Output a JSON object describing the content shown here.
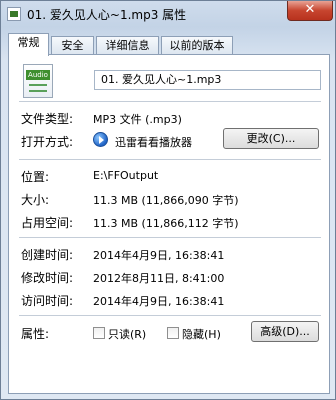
{
  "window": {
    "title": "01. 爱久见人心~1.mp3 属性",
    "close_label": "✕"
  },
  "tabs": [
    {
      "label": "常规",
      "active": true
    },
    {
      "label": "安全",
      "active": false
    },
    {
      "label": "详细信息",
      "active": false
    },
    {
      "label": "以前的版本",
      "active": false
    }
  ],
  "general": {
    "filename": "01. 爱久见人心~1.mp3",
    "file_icon_badge": "Audio",
    "type_label": "文件类型:",
    "type_value": "MP3 文件 (.mp3)",
    "opens_with_label": "打开方式:",
    "opens_with_app": "迅雷看看播放器",
    "change_button": "更改(C)...",
    "location_label": "位置:",
    "location_value": "E:\\FFOutput",
    "size_label": "大小:",
    "size_value": "11.3 MB (11,866,090 字节)",
    "size_on_disk_label": "占用空间:",
    "size_on_disk_value": "11.3 MB (11,866,112 字节)",
    "created_label": "创建时间:",
    "created_value": "2014年4月9日, 16:38:41",
    "modified_label": "修改时间:",
    "modified_value": "2012年8月11日, 8:41:00",
    "accessed_label": "访问时间:",
    "accessed_value": "2014年4月9日, 16:38:41",
    "attributes_label": "属性:",
    "readonly_label": "只读(R)",
    "readonly_checked": false,
    "hidden_label": "隐藏(H)",
    "hidden_checked": false,
    "advanced_button": "高级(D)..."
  },
  "icons": {
    "file": "audio-file-icon",
    "app": "xunlei-player-icon"
  }
}
